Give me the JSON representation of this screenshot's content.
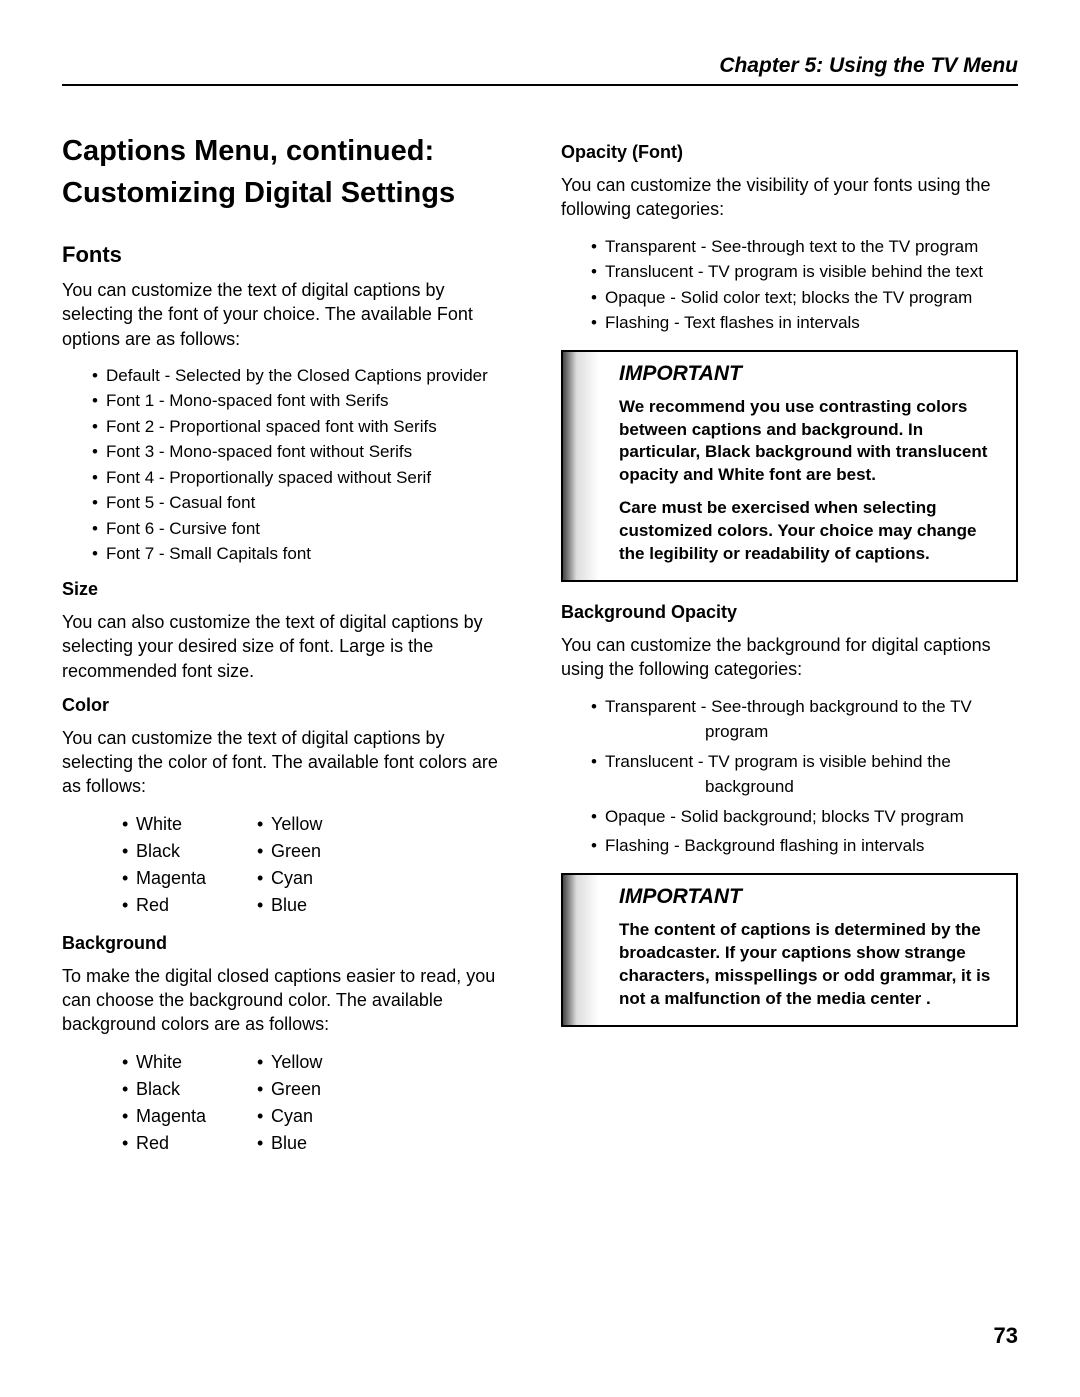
{
  "header": {
    "chapter": "Chapter 5:  Using the TV Menu"
  },
  "left": {
    "title": "Captions Menu, continued: Customizing Digital Settings",
    "fonts": {
      "heading": "Fonts",
      "intro": "You can customize the text of digital captions by selecting the font of your choice.  The available Font options are as follows:",
      "items": [
        "Default - Selected by the Closed Captions provider",
        "Font 1 - Mono-spaced font with Serifs",
        "Font 2 - Proportional spaced font with Serifs",
        "Font 3 - Mono-spaced font without Serifs",
        "Font 4 - Proportionally spaced without Serif",
        "Font 5 - Casual font",
        "Font 6 - Cursive font",
        "Font 7 - Small Capitals font"
      ]
    },
    "size": {
      "heading": "Size",
      "text": "You can also customize the text of digital captions by selecting your desired size of font.  Large is the recommended font size."
    },
    "color": {
      "heading": "Color",
      "text": "You can customize the text of digital captions by selecting the color of font.  The available font colors are as follows:",
      "grid": [
        "White",
        "Yellow",
        "Black",
        "Green",
        "Magenta",
        "Cyan",
        "Red",
        "Blue"
      ]
    },
    "background": {
      "heading": "Background",
      "text": "To make the digital closed captions easier to read, you can choose the background color.  The available background colors are as follows:",
      "grid": [
        "White",
        "Yellow",
        "Black",
        "Green",
        "Magenta",
        "Cyan",
        "Red",
        "Blue"
      ]
    }
  },
  "right": {
    "opacity_font": {
      "heading": "Opacity (Font)",
      "text": "You can customize the visibility of your fonts using the following categories:",
      "items": [
        "Transparent - See-through text to the TV program",
        "Translucent - TV program is visible behind the text",
        "Opaque - Solid color text; blocks the TV program",
        "Flashing - Text flashes in intervals"
      ]
    },
    "important1": {
      "title": "IMPORTANT",
      "p1": "We recommend you use contrasting colors between captions and background.  In particular, Black background with translucent opacity and White font are best.",
      "p2": "Care must be exercised when selecting customized colors.  Your choice may change the legibility or readability of captions."
    },
    "bg_opacity": {
      "heading": "Background Opacity",
      "text": "You can customize the background for digital captions using the following categories:",
      "items": [
        {
          "lead": "Transparent - ",
          "rest": "See-through background to the TV",
          "wrap": "program"
        },
        {
          "lead": "Translucent -  ",
          "rest": "TV program is visible behind the",
          "wrap": "background"
        },
        {
          "lead": "Opaque - Solid background; blocks TV program"
        },
        {
          "lead": "Flashing - Background flashing in intervals"
        }
      ]
    },
    "important2": {
      "title": "IMPORTANT",
      "p1": "The content of captions is determined by the broadcaster.  If your captions show strange characters, misspellings or odd grammar, it is not a malfunction of the media center ."
    }
  },
  "page_number": "73"
}
